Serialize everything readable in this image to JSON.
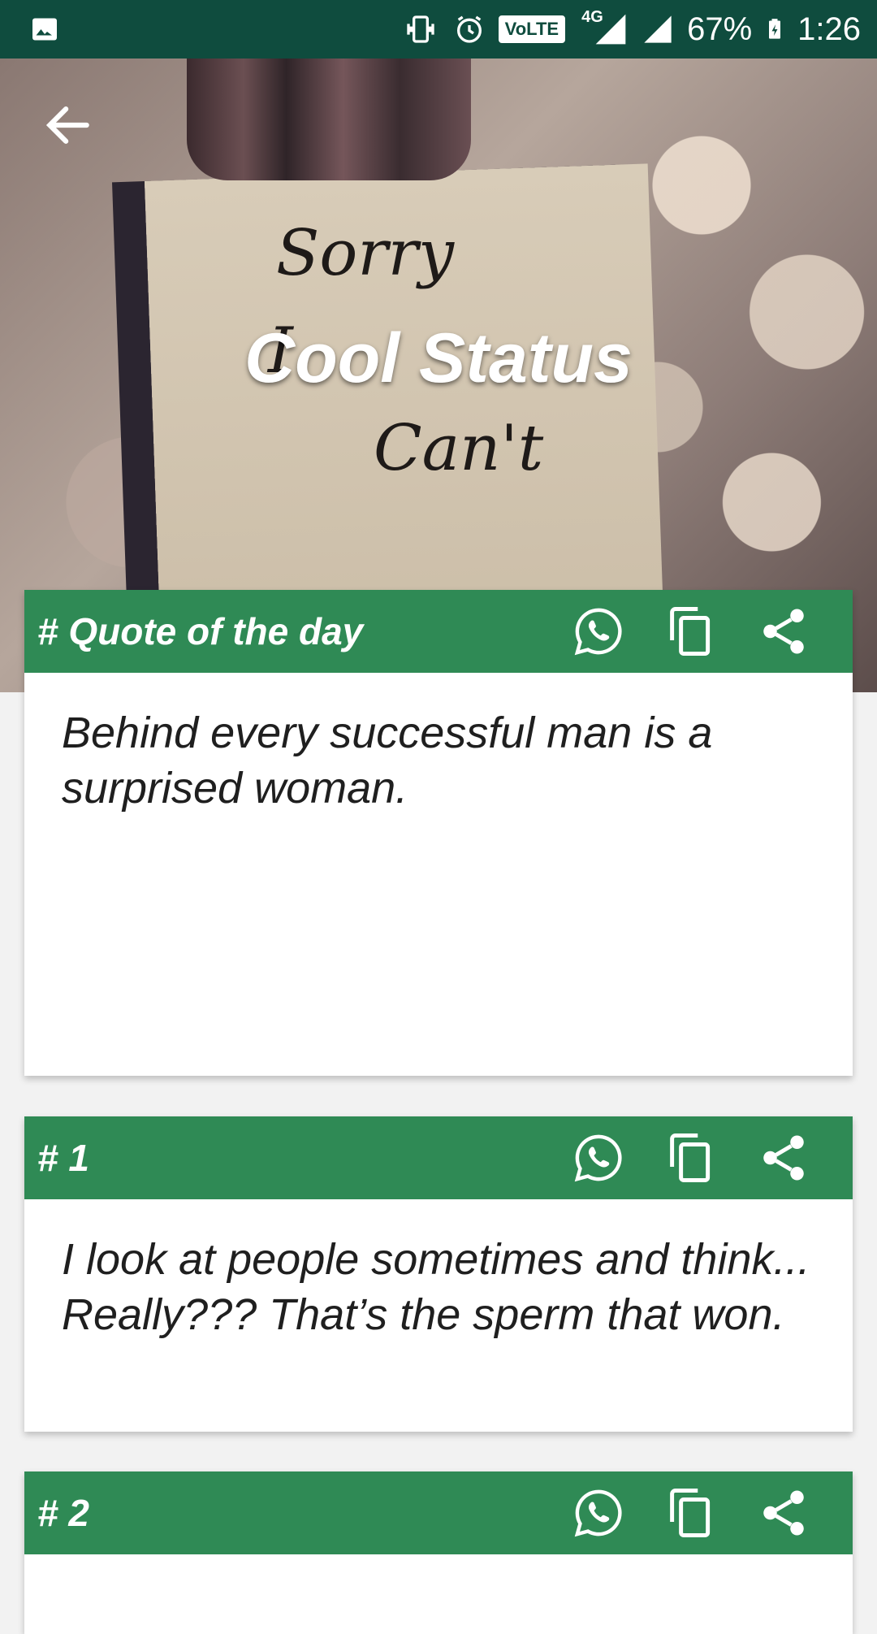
{
  "status_bar": {
    "volte_label": "VoLTE",
    "network": "4G",
    "battery": "67%",
    "time": "1:26",
    "icons": [
      "gallery-icon",
      "vibrate-icon",
      "alarm-icon",
      "volte-icon",
      "signal-4g-icon",
      "signal-icon",
      "battery-charging-icon"
    ]
  },
  "header": {
    "title": "Cool Status",
    "back_icon": "arrow-back-icon",
    "hero_image_text": [
      "Sorry",
      "I",
      "Can't"
    ]
  },
  "cards": [
    {
      "title": "# Quote of the day",
      "text": "Behind every successful man is a surprised woman."
    },
    {
      "title": "# 1",
      "text": "I look at people sometimes and think... Really??? That’s the sperm that won."
    },
    {
      "title": "# 2",
      "text": ""
    }
  ],
  "actions": [
    "whatsapp-icon",
    "copy-icon",
    "share-icon"
  ],
  "colors": {
    "status_bar": "#0f4c3e",
    "card_header": "#2f8a55",
    "background": "#f2f2f2"
  }
}
